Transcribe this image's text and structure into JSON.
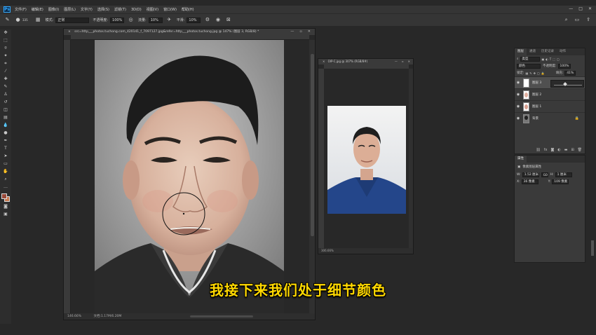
{
  "menubar": {
    "items": [
      "文件(F)",
      "编辑(E)",
      "图像(I)",
      "图层(L)",
      "文字(Y)",
      "选择(S)",
      "滤镜(T)",
      "3D(D)",
      "视图(V)",
      "窗口(W)",
      "帮助(H)"
    ],
    "logo": "Ps",
    "window_controls": [
      "—",
      "□",
      "✕"
    ]
  },
  "options": {
    "brush_size": "335",
    "mode_label": "模式:",
    "mode_value": "正常",
    "opacity_label": "不透明度:",
    "opacity_value": "100%",
    "flow_label": "流量:",
    "flow_value": "10%",
    "smooth_label": "平滑:",
    "smooth_value": "10%"
  },
  "document": {
    "tab_title": "src=http___photos.tuchong.com_420141_f_7097127.jpg&refer=http___photos.tuchong.jpg @ 147% (图层 3, RGB/8) *",
    "zoom": "146.66%",
    "doc_size": "文档:1.17M/6.20M"
  },
  "document2": {
    "tab_title": "OIP-C.jpg @ 307% (RGB/8#)",
    "zoom": "306.66%"
  },
  "layers": {
    "tabs": [
      "图层",
      "通道",
      "历史记录",
      "动作"
    ],
    "kind_label": "类型",
    "blend_mode": "颜色",
    "opacity_label": "不透明度:",
    "opacity_value": "100%",
    "lock_label": "锁定:",
    "fill_label": "填充:",
    "fill_value": "41%",
    "items": [
      {
        "name": "图层 3",
        "selected": true
      },
      {
        "name": "图层 2",
        "selected": false
      },
      {
        "name": "图层 1",
        "selected": false
      },
      {
        "name": "背景",
        "selected": false
      }
    ],
    "fill_slider_fraction": 0.41
  },
  "properties": {
    "tab": "属性",
    "title": "像素图层属性",
    "w_label": "W:",
    "w_value": "1.52 厘米",
    "h_label": "H:",
    "h_value": "1 厘米",
    "x_label": "X:",
    "x_value": "36 像素",
    "y_label": "Y:",
    "y_value": "109 像素",
    "link_label": "GO"
  },
  "subtitle": "我接下来我们处于细节颜色",
  "colors": {
    "foreground": "#9a4a3a",
    "background": "#c87a50",
    "subtitle": "#ffd800"
  }
}
